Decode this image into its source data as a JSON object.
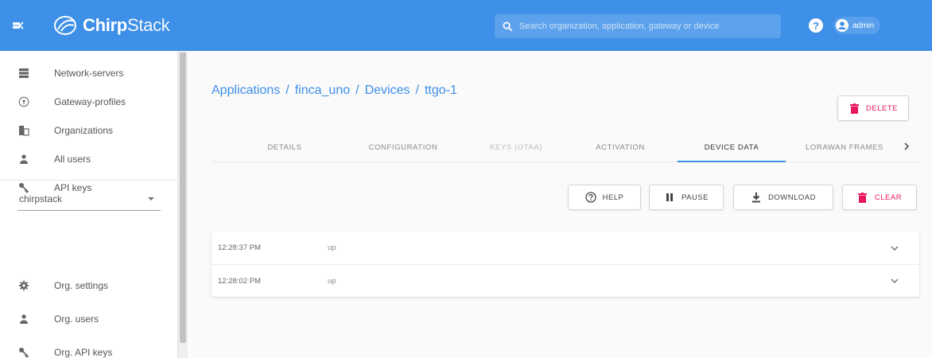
{
  "header": {
    "logo_bold": "Chirp",
    "logo_light": "Stack",
    "search_placeholder": "Search organization, application, gateway or device",
    "help_label": "?",
    "user_name": "admin",
    "brand_color": "#3d8fe8"
  },
  "sidebar": {
    "items": [
      {
        "label": "Network-servers",
        "icon": "server-icon"
      },
      {
        "label": "Gateway-profiles",
        "icon": "gateway-icon"
      },
      {
        "label": "Organizations",
        "icon": "domain-icon"
      },
      {
        "label": "All users",
        "icon": "user-icon"
      },
      {
        "label": "API keys",
        "icon": "key-icon"
      }
    ],
    "org_select": "chirpstack",
    "org_items": [
      {
        "label": "Org. settings",
        "icon": "gear-icon"
      },
      {
        "label": "Org. users",
        "icon": "user-icon"
      },
      {
        "label": "Org. API keys",
        "icon": "key-icon"
      }
    ]
  },
  "breadcrumb": {
    "applications": "Applications",
    "app": "finca_uno",
    "devices": "Devices",
    "device": "ttgo-1",
    "sep": "/"
  },
  "delete_label": "DELETE",
  "tabs": [
    {
      "label": "DETAILS",
      "state": "normal"
    },
    {
      "label": "CONFIGURATION",
      "state": "normal"
    },
    {
      "label": "KEYS (OTAA)",
      "state": "disabled"
    },
    {
      "label": "ACTIVATION",
      "state": "normal"
    },
    {
      "label": "DEVICE DATA",
      "state": "active"
    },
    {
      "label": "LORAWAN FRAMES",
      "state": "normal"
    }
  ],
  "actions": {
    "help": "HELP",
    "pause": "PAUSE",
    "download": "DOWNLOAD",
    "clear": "CLEAR"
  },
  "data_rows": [
    {
      "time": "12:28:37 PM",
      "direction": "up"
    },
    {
      "time": "12:28:02 PM",
      "direction": "up"
    }
  ],
  "colors": {
    "accent": "#3d8fe8",
    "danger": "#e8175d"
  }
}
